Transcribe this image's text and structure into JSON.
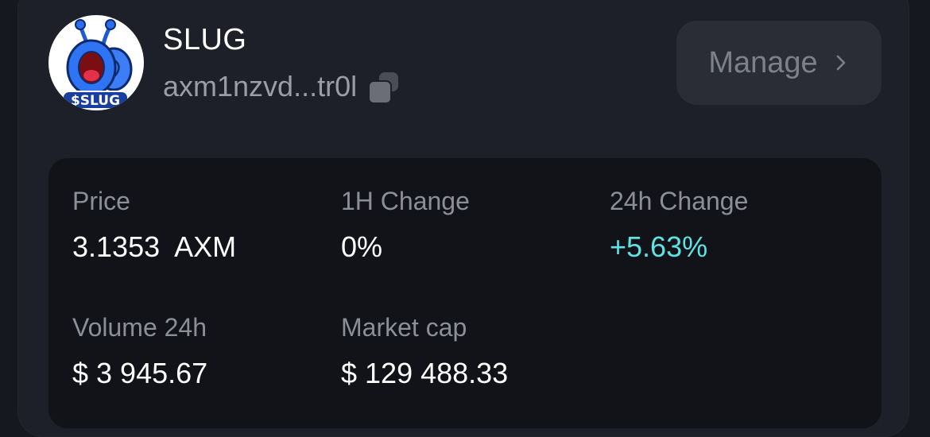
{
  "token": {
    "name": "SLUG",
    "address": "axm1nzvd...tr0l",
    "avatar_badge": "$SLUG"
  },
  "header": {
    "manage_label": "Manage",
    "copy_icon": "copy-icon",
    "chevron_icon": "chevron-right-icon"
  },
  "stats": {
    "price": {
      "label": "Price",
      "value": "3.1353  AXM"
    },
    "change_1h": {
      "label": "1H Change",
      "value": "0%"
    },
    "change_24h": {
      "label": "24h Change",
      "value": "+5.63%"
    },
    "volume_24h": {
      "label": "Volume 24h",
      "value": "$ 3 945.67"
    },
    "market_cap": {
      "label": "Market cap",
      "value": "$ 129 488.33"
    }
  },
  "colors": {
    "background": "#161820",
    "panel": "#1d2029",
    "stats_card": "#121318",
    "button": "#2a2d35",
    "positive": "#5ee3e3",
    "muted_text": "#8c8f97"
  }
}
